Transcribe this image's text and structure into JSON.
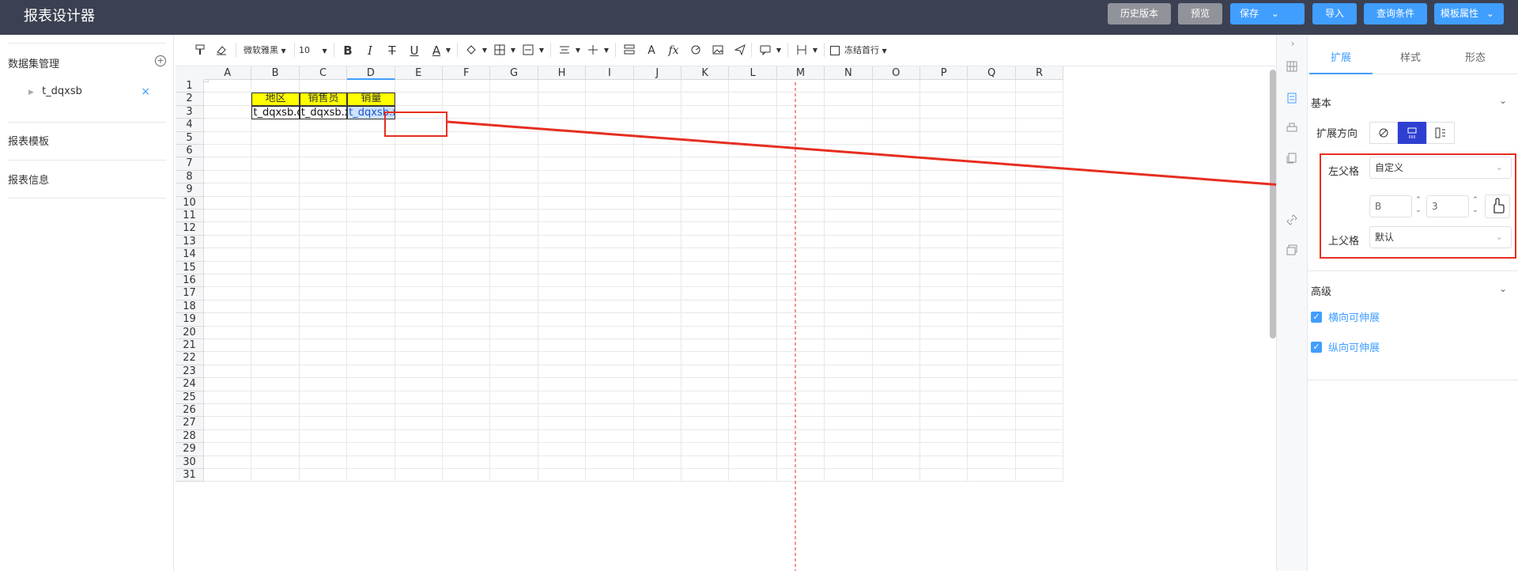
{
  "app": {
    "title": "报表设计器"
  },
  "header_buttons": {
    "history": "历史版本",
    "preview": "预览",
    "save": "保存",
    "import": "导入",
    "query": "查询条件",
    "template_props": "模板属性"
  },
  "left_panel": {
    "dataset_title": "数据集管理",
    "dataset_item": "t_dqxsb",
    "report_template": "报表模板",
    "report_info": "报表信息"
  },
  "toolbar": {
    "font_family": "微软雅黑",
    "font_size": "10",
    "freeze": "冻结首行"
  },
  "sheet": {
    "columns": [
      "A",
      "B",
      "C",
      "D",
      "E",
      "F",
      "G",
      "H",
      "I",
      "J",
      "K",
      "L",
      "M",
      "N",
      "O",
      "P",
      "Q",
      "R"
    ],
    "rows": [
      "1",
      "2",
      "3",
      "4",
      "5",
      "6",
      "7",
      "8",
      "9",
      "10",
      "11",
      "12",
      "13",
      "14",
      "15",
      "16",
      "17",
      "18",
      "19",
      "20",
      "21",
      "22",
      "23",
      "24",
      "25",
      "26",
      "27",
      "28",
      "29",
      "30",
      "31"
    ],
    "headers": [
      "地区",
      "销售员",
      "销量"
    ],
    "values": [
      "t_dqxsb.dq",
      "t_dqxsb.xs",
      "t_dqxsb.xl"
    ]
  },
  "right_panel": {
    "tabs": [
      "扩展",
      "样式",
      "形态"
    ],
    "basic_title": "基本",
    "expand_direction_label": "扩展方向",
    "left_parent_label": "左父格",
    "left_parent_value": "自定义",
    "col_value": "B",
    "row_value": "3",
    "top_parent_label": "上父格",
    "top_parent_value": "默认",
    "advanced_title": "高级",
    "horizontal_expand": "横向可伸展",
    "vertical_expand": "纵向可伸展"
  },
  "colors": {
    "header_bg": "#3b4152",
    "accent": "#409eff",
    "highlight": "#ffff00",
    "annotation": "#e62e20"
  }
}
